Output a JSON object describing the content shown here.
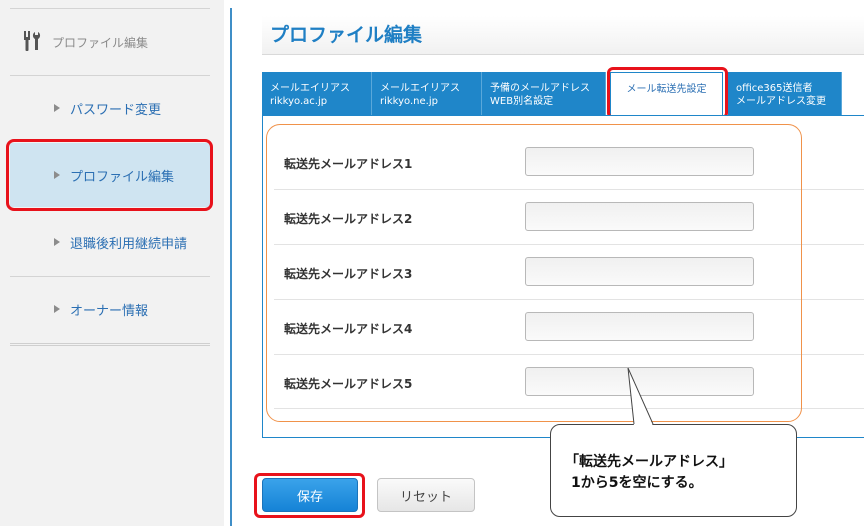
{
  "sidebar": {
    "header": "プロファイル編集",
    "items": [
      {
        "label": "パスワード変更"
      },
      {
        "label": "プロファイル編集"
      },
      {
        "label": "退職後利用継続申請"
      },
      {
        "label": "オーナー情報"
      }
    ]
  },
  "main": {
    "title": "プロファイル編集",
    "tabs": [
      {
        "line1": "メールエイリアス",
        "line2": "rikkyo.ac.jp"
      },
      {
        "line1": "メールエイリアス",
        "line2": "rikkyo.ne.jp"
      },
      {
        "line1": "予備のメールアドレス",
        "line2": "WEB別名設定"
      },
      {
        "line1": "メール転送先設定",
        "line2": ""
      },
      {
        "line1": "office365送信者",
        "line2": "メールアドレス変更"
      }
    ],
    "active_tab": "メール転送先設定",
    "fields": [
      {
        "label": "転送先メールアドレス1",
        "value": ""
      },
      {
        "label": "転送先メールアドレス2",
        "value": ""
      },
      {
        "label": "転送先メールアドレス3",
        "value": ""
      },
      {
        "label": "転送先メールアドレス4",
        "value": ""
      },
      {
        "label": "転送先メールアドレス5",
        "value": ""
      }
    ],
    "save_label": "保存",
    "reset_label": "リセット"
  },
  "annotation": {
    "line1": "「転送先メールアドレス」",
    "line2": "1から5を空にする。"
  },
  "colors": {
    "accent": "#1f86c9",
    "highlight": "#e8121b",
    "group_outline": "#f0924a",
    "sidebar_active": "#cfe4f1"
  }
}
